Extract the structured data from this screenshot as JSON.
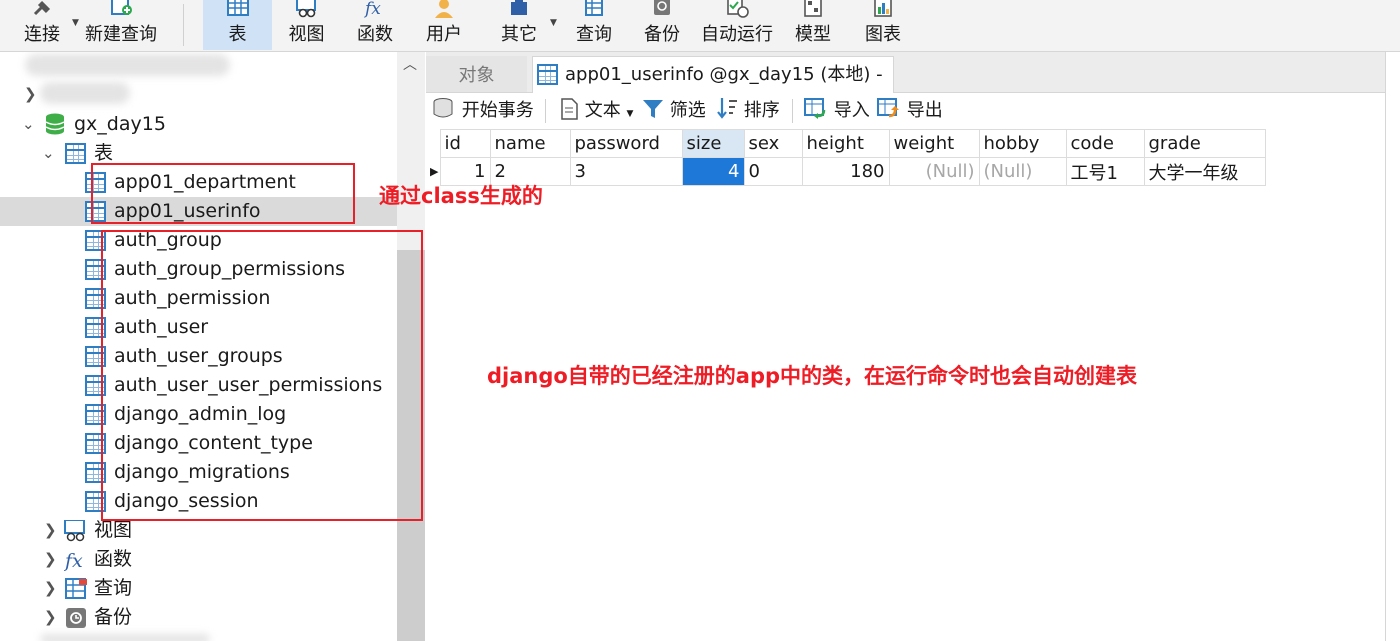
{
  "toolbar": {
    "connect": "连接",
    "new_query": "新建查询",
    "table": "表",
    "view": "视图",
    "function": "函数",
    "user": "用户",
    "other": "其它",
    "query": "查询",
    "backup": "备份",
    "autorun": "自动运行",
    "model": "模型",
    "chart": "图表"
  },
  "tree": {
    "database": "gx_day15",
    "tables_label": "表",
    "tables": [
      "app01_department",
      "app01_userinfo",
      "auth_group",
      "auth_group_permissions",
      "auth_permission",
      "auth_user",
      "auth_user_groups",
      "auth_user_user_permissions",
      "django_admin_log",
      "django_content_type",
      "django_migrations",
      "django_session"
    ],
    "groups": [
      "视图",
      "函数",
      "查询",
      "备份"
    ]
  },
  "tabs": {
    "objects": "对象",
    "active": "app01_userinfo @gx_day15 (本地) - ..."
  },
  "subtoolbar": {
    "begin_transaction": "开始事务",
    "text": "文本",
    "filter": "筛选",
    "sort": "排序",
    "import": "导入",
    "export": "导出"
  },
  "grid": {
    "columns": [
      "id",
      "name",
      "password",
      "size",
      "sex",
      "height",
      "weight",
      "hobby",
      "code",
      "grade"
    ],
    "rows": [
      [
        "1",
        "2",
        "3",
        "4",
        "0",
        "180",
        "(Null)",
        "(Null)",
        "工号1",
        "大学一年级"
      ]
    ]
  },
  "annotations": {
    "class_generated": "通过class生成的",
    "django_builtin": "django自带的已经注册的app中的类，在运行命令时也会自动创建表"
  },
  "colors": {
    "annotation": "#ee1c25",
    "selection": "#1e78d7",
    "active_tool": "#cfe2f6"
  }
}
